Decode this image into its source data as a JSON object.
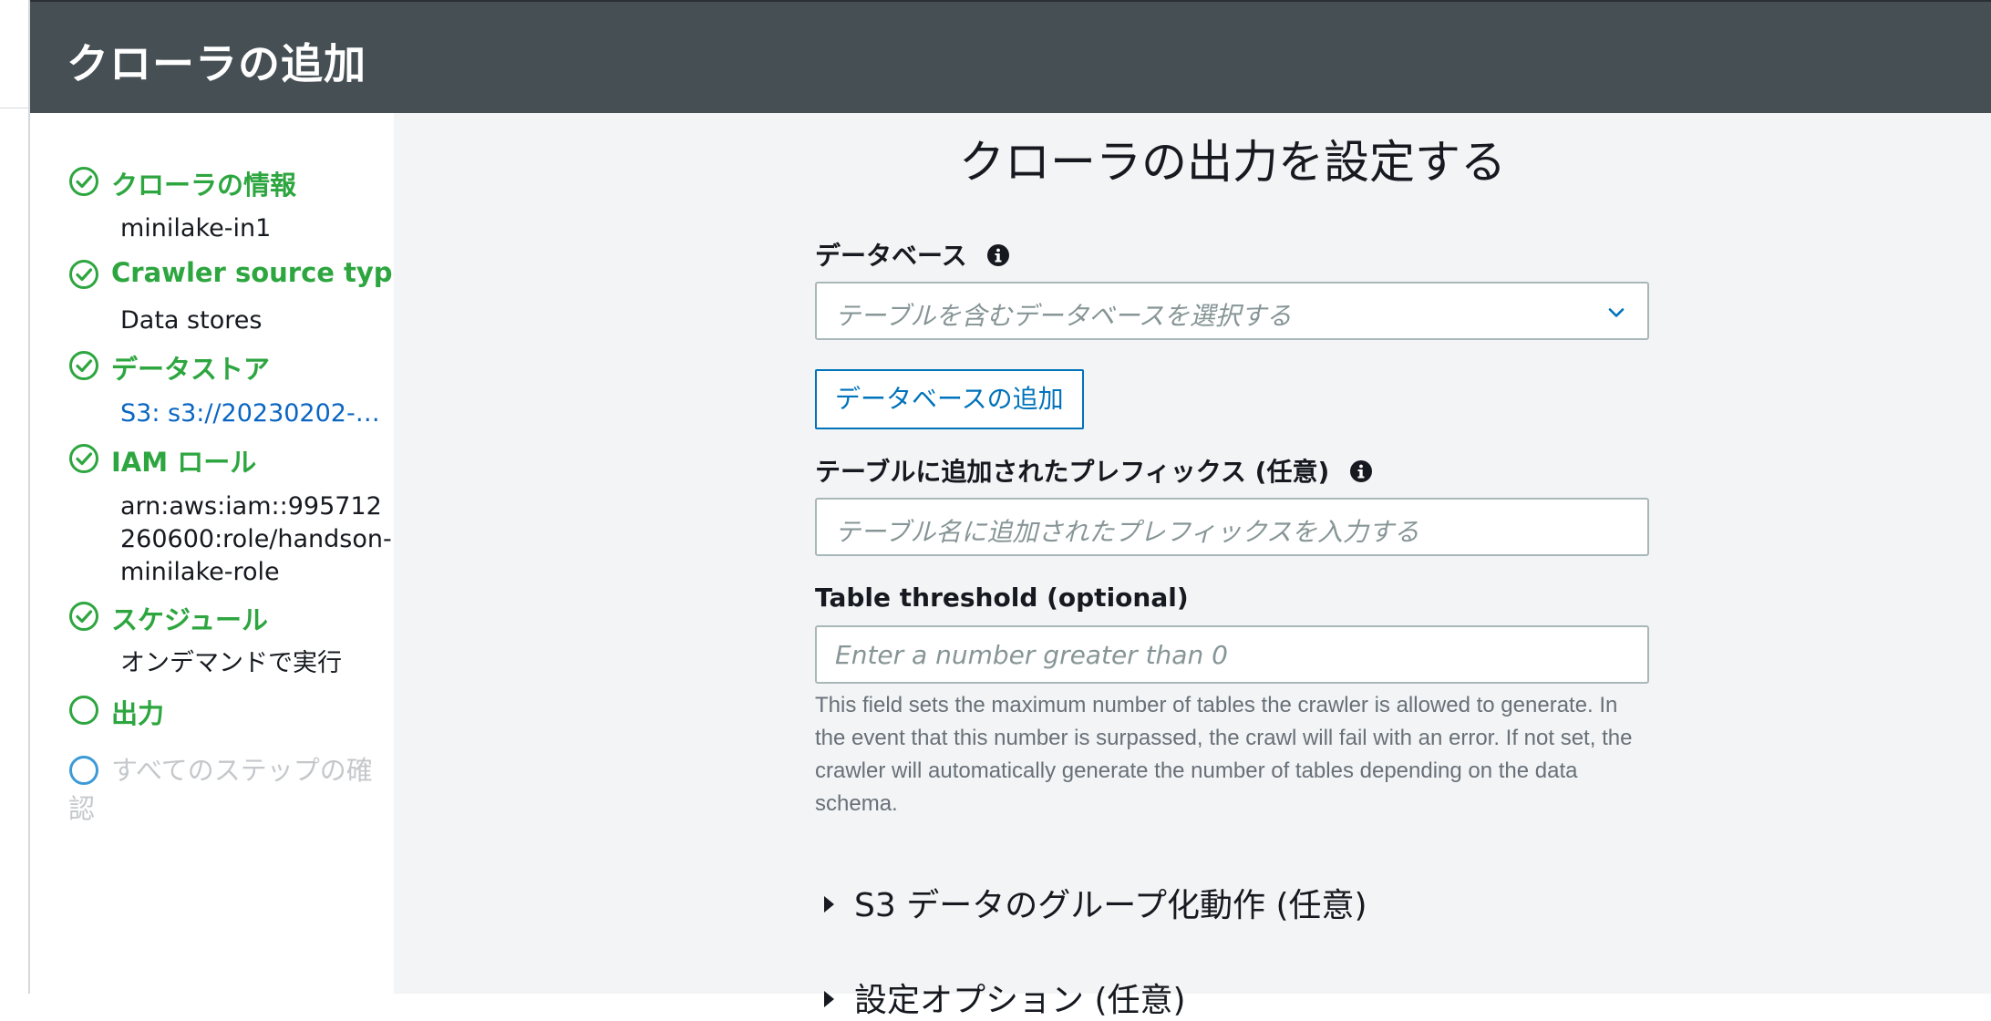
{
  "header": {
    "title": "クローラの追加"
  },
  "steps": [
    {
      "title": "クローラの情報",
      "detail": "minilake-in1",
      "state": "done"
    },
    {
      "title": "Crawler source type",
      "detail": "Data stores",
      "state": "done"
    },
    {
      "title": "データストア",
      "detail": "S3: s3://20230202-…",
      "state": "done",
      "detail_is_link": true
    },
    {
      "title": "IAM ロール",
      "detail": "arn:aws:iam::995712260600:role/handson-minilake-role",
      "state": "done"
    },
    {
      "title": "スケジュール",
      "detail": "オンデマンドで実行",
      "state": "done"
    },
    {
      "title": "出力",
      "state": "current"
    },
    {
      "title": "すべてのステップの確認",
      "state": "upcoming"
    }
  ],
  "main": {
    "title": "クローラの出力を設定する",
    "database": {
      "label": "データベース",
      "placeholder": "テーブルを含むデータベースを選択する",
      "add_button": "データベースの追加"
    },
    "prefix": {
      "label": "テーブルに追加されたプレフィックス (任意)",
      "placeholder": "テーブル名に追加されたプレフィックスを入力する"
    },
    "threshold": {
      "label": "Table threshold (optional)",
      "placeholder": "Enter a number greater than 0",
      "help": "This field sets the maximum number of tables the crawler is allowed to generate. In the event that this number is surpassed, the crawl will fail with an error. If not set, the crawler will automatically generate the number of tables depending on the data schema."
    },
    "grouping_section": "S3 データのグループ化動作 (任意)",
    "config_section": "設定オプション (任意)"
  },
  "colors": {
    "header_bg": "#464f54",
    "step_done": "#2ea640",
    "step_upcoming": "#3d9ad8",
    "link": "#0a66c2",
    "main_bg": "#f2f4f5"
  }
}
